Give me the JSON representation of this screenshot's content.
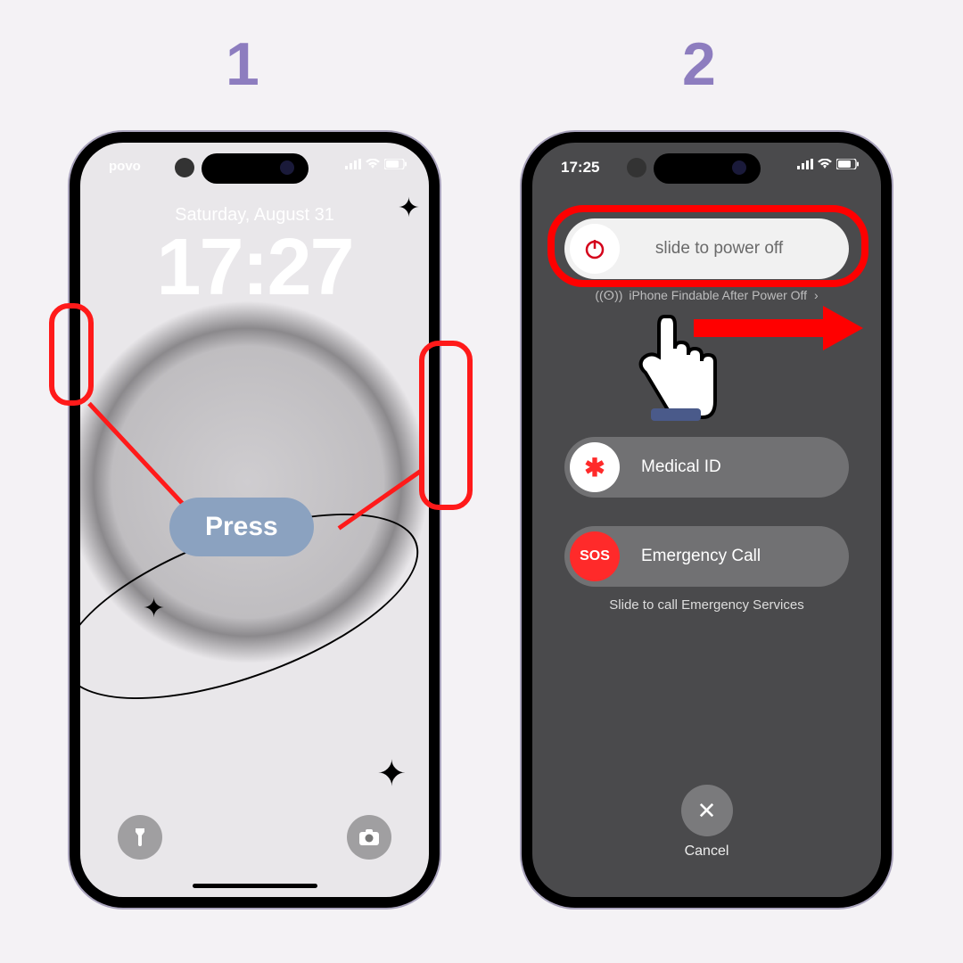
{
  "steps": {
    "one": "1",
    "two": "2"
  },
  "phone1": {
    "carrier": "povo",
    "date": "Saturday, August 31",
    "time": "17:27",
    "press_label": "Press"
  },
  "phone2": {
    "time": "17:25",
    "power_off": "slide to power off",
    "findable": "iPhone Findable After Power Off",
    "medical": "Medical ID",
    "emergency": "Emergency Call",
    "sos_hint": "Slide to call Emergency Services",
    "sos_knob": "SOS",
    "cancel": "Cancel"
  }
}
